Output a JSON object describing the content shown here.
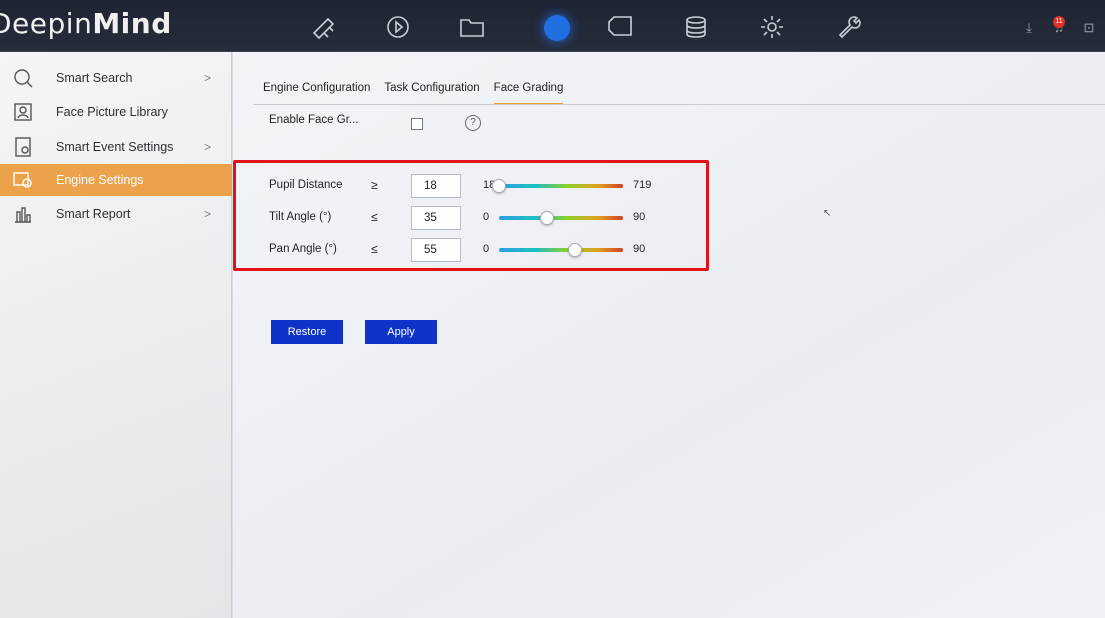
{
  "app": {
    "logo_prefix": "Deepin",
    "logo_suffix": "Mind"
  },
  "topnav": {
    "icons": [
      "search-ai-icon",
      "playback-icon",
      "folder-icon",
      "smart-search-icon",
      "tag-icon",
      "storage-icon",
      "settings-gear-icon",
      "wrench-icon"
    ],
    "active_index": 3,
    "alarm_count": "11"
  },
  "sidebar": {
    "items": [
      {
        "label": "Smart Search",
        "icon": "smart-search-icon",
        "chevron": ">"
      },
      {
        "label": "Face Picture Library",
        "icon": "face-library-icon",
        "chevron": ""
      },
      {
        "label": "Smart Event Settings",
        "icon": "event-settings-icon",
        "chevron": ">"
      },
      {
        "label": "Engine Settings",
        "icon": "engine-settings-icon",
        "chevron": "",
        "active": true
      },
      {
        "label": "Smart Report",
        "icon": "report-icon",
        "chevron": ">"
      }
    ]
  },
  "tabs": [
    {
      "label": "Engine Configuration"
    },
    {
      "label": "Task Configuration"
    },
    {
      "label": "Face Grading",
      "active": true
    }
  ],
  "enable": {
    "label": "Enable Face Gr...",
    "checked": false,
    "help": "?"
  },
  "grading": [
    {
      "label": "Pupil Distance",
      "operator": "≥",
      "value": "18",
      "min": "18",
      "max": "719",
      "level": 0.0
    },
    {
      "label": "Tilt Angle (°)",
      "operator": "≤",
      "value": "35",
      "min": "0",
      "max": "90",
      "level": 0.39
    },
    {
      "label": "Pan Angle (°)",
      "operator": "≤",
      "value": "55",
      "min": "0",
      "max": "90",
      "level": 0.61
    }
  ],
  "buttons": {
    "restore": "Restore",
    "apply": "Apply"
  },
  "colors": {
    "accent": "#eba24a",
    "button": "#0f33c8",
    "highlight": "#e0141c",
    "topbar": "#1e2432"
  }
}
